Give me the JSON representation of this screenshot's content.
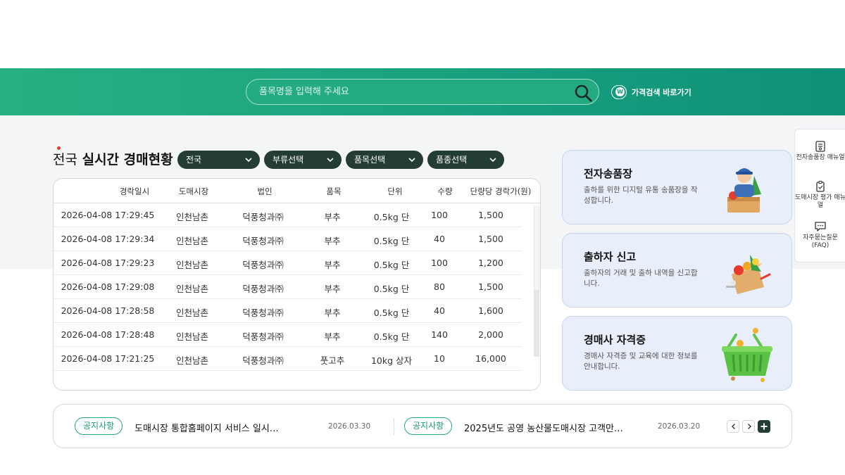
{
  "search": {
    "placeholder": "품목명을 입력해 주세요",
    "shortcut_label": "가격검색 바로가기",
    "shortcut_badge": "W"
  },
  "section": {
    "title_prefix": "전국",
    "title_main": "실시간 경매현황"
  },
  "filters": [
    {
      "label": "전국"
    },
    {
      "label": "부류선택"
    },
    {
      "label": "품목선택"
    },
    {
      "label": "품종선택"
    }
  ],
  "table": {
    "headers": [
      "경락일시",
      "도매시장",
      "법인",
      "품목",
      "단위",
      "수량",
      "단량당 경락가(원)"
    ],
    "rows": [
      [
        "2026-04-08 17:29:45",
        "인천남촌",
        "덕풍청과㈜",
        "부추",
        "0.5kg 단",
        "100",
        "1,500"
      ],
      [
        "2026-04-08 17:29:34",
        "인천남촌",
        "덕풍청과㈜",
        "부추",
        "0.5kg 단",
        "40",
        "1,500"
      ],
      [
        "2026-04-08 17:29:23",
        "인천남촌",
        "덕풍청과㈜",
        "부추",
        "0.5kg 단",
        "100",
        "1,200"
      ],
      [
        "2026-04-08 17:29:08",
        "인천남촌",
        "덕풍청과㈜",
        "부추",
        "0.5kg 단",
        "80",
        "1,500"
      ],
      [
        "2026-04-08 17:28:58",
        "인천남촌",
        "덕풍청과㈜",
        "부추",
        "0.5kg 단",
        "40",
        "1,600"
      ],
      [
        "2026-04-08 17:28:48",
        "인천남촌",
        "덕풍청과㈜",
        "부추",
        "0.5kg 단",
        "140",
        "2,000"
      ],
      [
        "2026-04-08 17:21:25",
        "인천남촌",
        "덕풍청과㈜",
        "풋고추",
        "10kg 상자",
        "10",
        "16,000"
      ]
    ]
  },
  "cards": [
    {
      "title": "전자송품장",
      "desc": "출하를 위한 디지털 유통 송품장을 작성합니다.",
      "icon": "farmer-with-vegetable-box-icon"
    },
    {
      "title": "출하자 신고",
      "desc": "출하자의 거래 및 출하 내역을 신고합니다.",
      "icon": "vegetable-box-icon"
    },
    {
      "title": "경매사 자격증",
      "desc": "경매사 자격증 및 교육에 대한 정보를 안내합니다.",
      "icon": "green-basket-icon"
    }
  ],
  "side_menu": [
    {
      "label": "전자송품장 매뉴얼",
      "icon": "document-icon"
    },
    {
      "label": "도매시장 평가 매뉴얼",
      "icon": "clipboard-icon"
    },
    {
      "label": "자주묻는질문 (FAQ)",
      "icon": "chat-icon"
    }
  ],
  "notices": [
    {
      "badge": "공지사항",
      "title": "도매시장 통합홈페이지 서비스 일시…",
      "date": "2026.03.30"
    },
    {
      "badge": "공지사항",
      "title": "2025년도 공영 농산물도매시장 고객만…",
      "date": "2026.03.20"
    }
  ],
  "colors": {
    "brand_green": "#1aa27f",
    "dark_green": "#243c36",
    "card_bg": "#e9eefb"
  }
}
